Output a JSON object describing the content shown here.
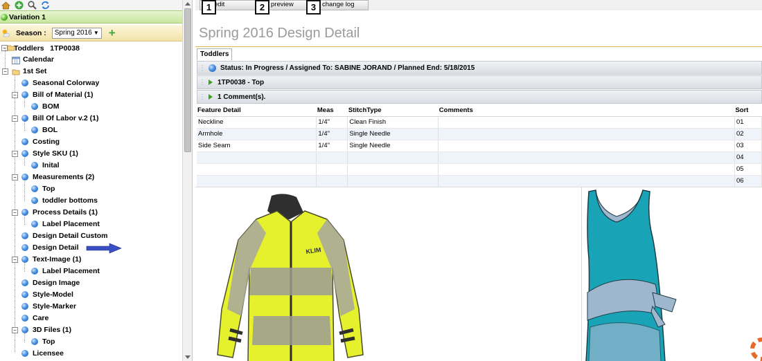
{
  "left": {
    "toolbar": {
      "icons": [
        "home-icon",
        "add-icon",
        "search-icon",
        "refresh-icon"
      ]
    },
    "variation": {
      "label": "Variation 1"
    },
    "season": {
      "label": "Season :",
      "value": "Spring 2016"
    },
    "tree": {
      "root": {
        "label": "Toddlers   1TP0038"
      },
      "items": [
        {
          "label": "Calendar"
        },
        {
          "label": "1st Set"
        },
        {
          "label": "Seasonal Colorway"
        },
        {
          "label": "Bill of Material (1)"
        },
        {
          "label": "BOM"
        },
        {
          "label": "Bill Of Labor v.2 (1)"
        },
        {
          "label": "BOL"
        },
        {
          "label": "Costing"
        },
        {
          "label": "Style SKU (1)"
        },
        {
          "label": "Inital"
        },
        {
          "label": "Measurements (2)"
        },
        {
          "label": "Top"
        },
        {
          "label": "toddler bottoms"
        },
        {
          "label": "Process Details (1)"
        },
        {
          "label": "Label Placement"
        },
        {
          "label": "Design Detail Custom"
        },
        {
          "label": "Design Detail"
        },
        {
          "label": "Text-Image (1)"
        },
        {
          "label": "Label Placement"
        },
        {
          "label": "Design Image"
        },
        {
          "label": "Style-Model"
        },
        {
          "label": "Style-Marker"
        },
        {
          "label": "Care"
        },
        {
          "label": "3D Files (1)"
        },
        {
          "label": "Top"
        },
        {
          "label": "Licensee"
        }
      ]
    }
  },
  "right": {
    "tabs": [
      {
        "label": "edit",
        "num": "1"
      },
      {
        "label": "preview",
        "num": "2"
      },
      {
        "label": "change log",
        "num": "3"
      }
    ],
    "title": "Spring 2016 Design Detail",
    "subtab": "Toddlers",
    "status": "Status: In Progress / Assigned To: SABINE JORAND / Planned End: 5/18/2015",
    "section_top": "1TP0038 - Top",
    "section_comments": "1 Comment(s).",
    "table": {
      "headers": [
        "Feature Detail",
        "Meas",
        "StitchType",
        "Comments",
        "Sort"
      ],
      "rows": [
        [
          "Neckline",
          "1/4\"",
          "Clean Finish",
          "",
          "01"
        ],
        [
          "Armhole",
          "1/4\"",
          "Single Needle",
          "",
          "02"
        ],
        [
          "Side Seam",
          "1/4\"",
          "Single Needle",
          "",
          "03"
        ],
        [
          "",
          "",
          "",
          "",
          "04"
        ],
        [
          "",
          "",
          "",
          "",
          "05"
        ],
        [
          "",
          "",
          "",
          "",
          "06"
        ]
      ]
    },
    "images": {
      "left": {
        "brand": "KLIM"
      }
    }
  },
  "colors": {
    "variation_bar": "#d5ecb5",
    "season_bar": "#f7ebbd",
    "title_rule": "#e1b54c",
    "tree_ball": "#4a90e2",
    "arrow": "#3b4fc4",
    "jacket_yellow": "#e6f12d",
    "dress_teal": "#19a3b6"
  }
}
